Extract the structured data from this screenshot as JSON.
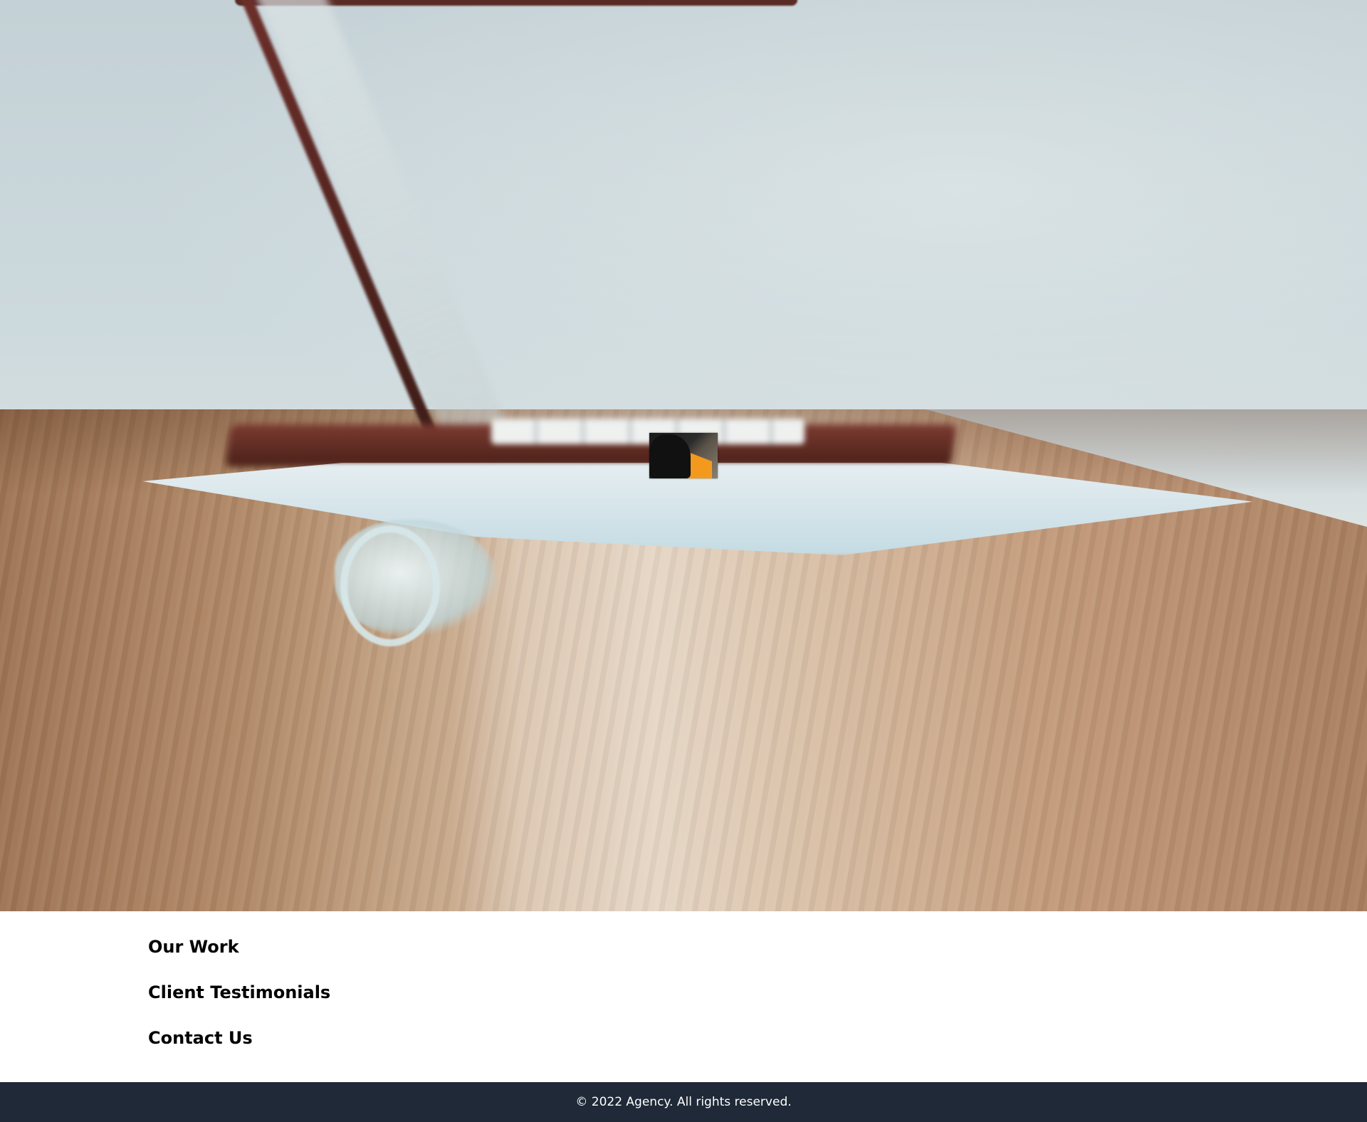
{
  "hero": {
    "background_image": "laptop-on-wooden-desk",
    "thumbnail_image": "person-in-black-and-orange-jacket"
  },
  "nav": {
    "items": [
      {
        "label": "Our Work"
      },
      {
        "label": "Client Testimonials"
      },
      {
        "label": "Contact Us"
      }
    ]
  },
  "footer": {
    "copyright": "© 2022 Agency. All rights reserved.",
    "background_color": "#1f2937",
    "text_color": "#ffffff"
  }
}
